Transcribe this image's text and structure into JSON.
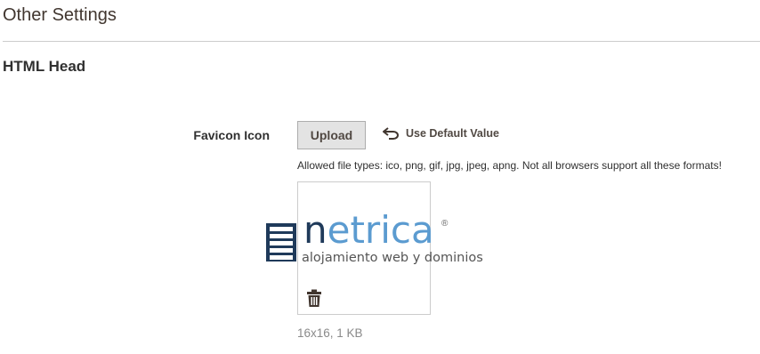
{
  "section": {
    "title": "Other Settings"
  },
  "subsection": {
    "title": "HTML Head"
  },
  "favicon": {
    "label": "Favicon Icon",
    "upload_label": "Upload",
    "default_value_label": "Use Default Value",
    "note": "Allowed file types: ico, png, gif, jpg, jpeg, apng. Not all browsers support all these formats!",
    "file_info": "16x16, 1 KB",
    "preview": {
      "logo_text_dark": "n",
      "logo_text_light": "etrica",
      "registered_mark": "®",
      "tagline": "alojamiento web y dominios"
    }
  },
  "icons": {
    "default_value": "undo-arrow-icon",
    "delete": "trash-icon",
    "logo_mark": "server-stack-icon"
  },
  "colors": {
    "logo_dark": "#1f3a5a",
    "logo_light": "#5b9bd0",
    "button_bg": "#e3e3e3"
  }
}
